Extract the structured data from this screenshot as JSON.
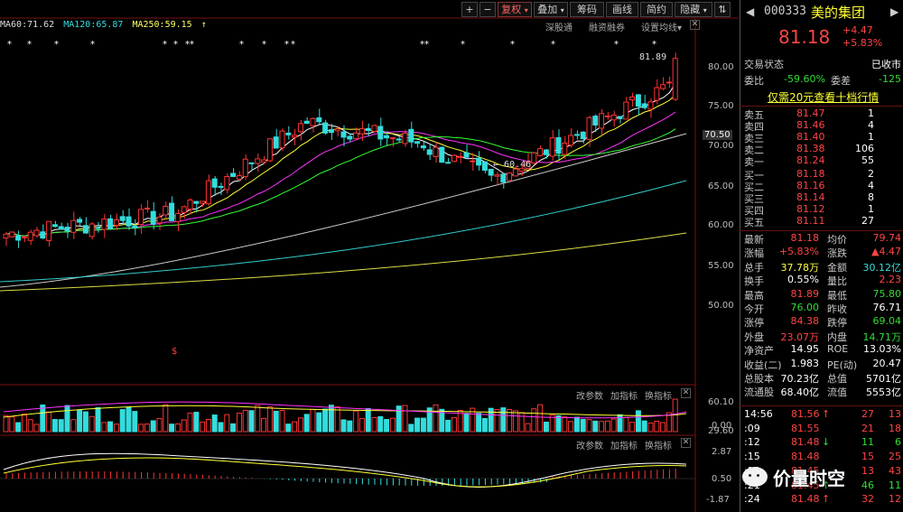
{
  "toolbar": {
    "plus": "+",
    "minus": "−",
    "fuquan": "复权",
    "diejia": "叠加",
    "choumai": "筹码",
    "huaxian": "画线",
    "jianyue": "简约",
    "yincang": "隐藏",
    "swap_icon": "⇅",
    "close": "✕"
  },
  "ma_legend": {
    "ma60": "MA60:71.62",
    "ma120": "MA120:65.87",
    "ma250": "MA250:59.15"
  },
  "top_links": {
    "shengutong": "深股通",
    "rongzirongquan": "融资融券",
    "set_ma": "设置均线"
  },
  "price_axis": [
    "80.00",
    "75.00",
    "70.50",
    "70.00",
    "65.00",
    "60.00",
    "55.00",
    "50.00"
  ],
  "annotations": {
    "high": "81.89",
    "low": "60.46",
    "dividend_marker": "$"
  },
  "volume_panel": {
    "change_params": "改参数",
    "add_indicator": "加指标",
    "switch_indicator": "换指标",
    "axis": [
      "60.10",
      "29.60",
      "0.00"
    ]
  },
  "macd_panel": {
    "change_params": "改参数",
    "add_indicator": "加指标",
    "switch_indicator": "换指标",
    "axis": [
      "2.87",
      "0.50",
      "-1.87"
    ]
  },
  "quote": {
    "code": "000333",
    "name": "美的集团",
    "price": "81.18",
    "change": "+4.47",
    "change_pct": "+5.83%",
    "status_label": "交易状态",
    "status_value": "已收市",
    "weibi_label": "委比",
    "weibi_value": "-59.60%",
    "weicha_label": "委差",
    "weicha_value": "-125",
    "promo": "仅需20元查看十档行情",
    "asks": [
      {
        "label": "卖五",
        "price": "81.47",
        "vol": "1"
      },
      {
        "label": "卖四",
        "price": "81.46",
        "vol": "4"
      },
      {
        "label": "卖三",
        "price": "81.40",
        "vol": "1"
      },
      {
        "label": "卖二",
        "price": "81.38",
        "vol": "106"
      },
      {
        "label": "卖一",
        "price": "81.24",
        "vol": "55"
      }
    ],
    "bids": [
      {
        "label": "买一",
        "price": "81.18",
        "vol": "2"
      },
      {
        "label": "买二",
        "price": "81.16",
        "vol": "4"
      },
      {
        "label": "买三",
        "price": "81.14",
        "vol": "8"
      },
      {
        "label": "买四",
        "price": "81.12",
        "vol": "1"
      },
      {
        "label": "买五",
        "price": "81.11",
        "vol": "27"
      }
    ],
    "stats": [
      {
        "l1": "最新",
        "v1": "81.18",
        "c1": "red",
        "l2": "均价",
        "v2": "79.74",
        "c2": "red"
      },
      {
        "l1": "涨幅",
        "v1": "+5.83%",
        "c1": "red",
        "l2": "涨跌",
        "v2": "▲4.47",
        "c2": "red"
      },
      {
        "l1": "总手",
        "v1": "37.78万",
        "c1": "yellow",
        "l2": "金额",
        "v2": "30.12亿",
        "c2": "cyan"
      },
      {
        "l1": "换手",
        "v1": "0.55%",
        "c1": "white",
        "l2": "量比",
        "v2": "2.23",
        "c2": "red"
      },
      {
        "l1": "最高",
        "v1": "81.89",
        "c1": "red",
        "l2": "最低",
        "v2": "75.80",
        "c2": "green"
      },
      {
        "l1": "今开",
        "v1": "76.00",
        "c1": "green",
        "l2": "昨收",
        "v2": "76.71",
        "c2": "white"
      },
      {
        "l1": "涨停",
        "v1": "84.38",
        "c1": "red",
        "l2": "跌停",
        "v2": "69.04",
        "c2": "green"
      },
      {
        "l1": "外盘",
        "v1": "23.07万",
        "c1": "red",
        "l2": "内盘",
        "v2": "14.71万",
        "c2": "green"
      },
      {
        "l1": "净资产",
        "v1": "14.95",
        "c1": "white",
        "l2": "ROE",
        "v2": "13.03%",
        "c2": "white"
      },
      {
        "l1": "收益(二)",
        "v1": "1.983",
        "c1": "white",
        "l2": "PE(动)",
        "v2": "20.47",
        "c2": "white"
      },
      {
        "l1": "总股本",
        "v1": "70.23亿",
        "c1": "white",
        "l2": "总值",
        "v2": "5701亿",
        "c2": "white"
      },
      {
        "l1": "流通股",
        "v1": "68.40亿",
        "c1": "white",
        "l2": "流值",
        "v2": "5553亿",
        "c2": "white"
      }
    ],
    "ticks": [
      {
        "time": "14:56",
        "price": "81.56",
        "arrow": "↑",
        "vol": "27",
        "n": "13",
        "pc": "red",
        "vc": "red"
      },
      {
        "time": ":09",
        "price": "81.55",
        "arrow": "",
        "vol": "21",
        "n": "18",
        "pc": "red",
        "vc": "red"
      },
      {
        "time": ":12",
        "price": "81.48",
        "arrow": "↓",
        "vol": "11",
        "n": "6",
        "pc": "red",
        "vc": "green"
      },
      {
        "time": ":15",
        "price": "81.48",
        "arrow": "",
        "vol": "15",
        "n": "25",
        "pc": "red",
        "vc": "red"
      },
      {
        "time": ":18",
        "price": "81.45",
        "arrow": "",
        "vol": "13",
        "n": "43",
        "pc": "red",
        "vc": "red"
      },
      {
        "time": ":21",
        "price": "81.45",
        "arrow": "↑",
        "vol": "46",
        "n": "11",
        "pc": "red",
        "vc": "green"
      },
      {
        "time": ":24",
        "price": "81.48",
        "arrow": "↑",
        "vol": "32",
        "n": "12",
        "pc": "red",
        "vc": "red"
      }
    ]
  },
  "watermark": "价量时空"
}
